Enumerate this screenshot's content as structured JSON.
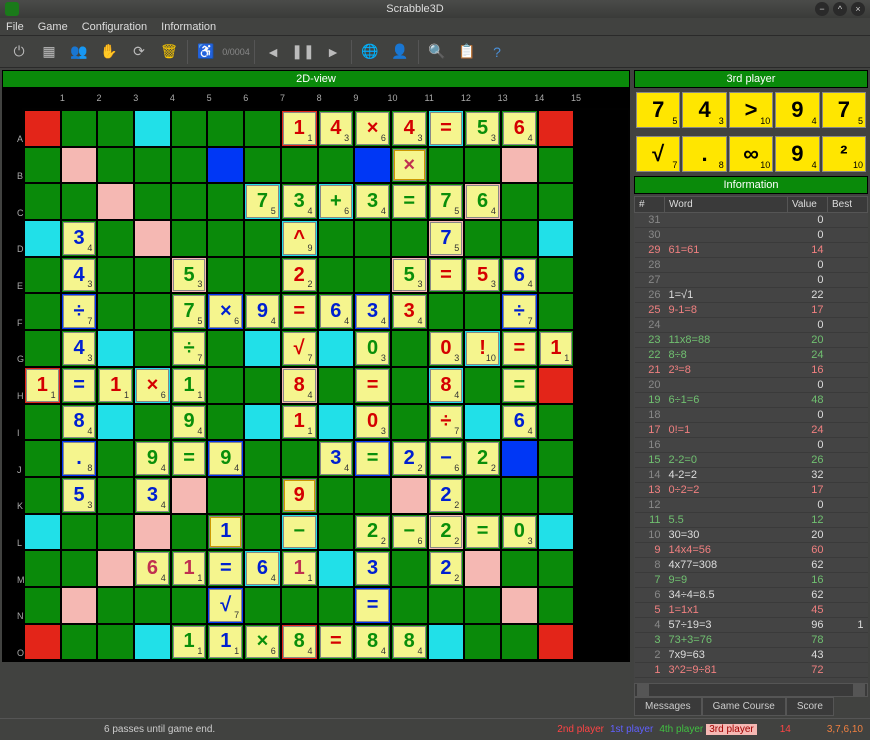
{
  "window": {
    "title": "Scrabble3D"
  },
  "menu": [
    "File",
    "Game",
    "Configuration",
    "Information"
  ],
  "view_header": "2D-view",
  "player_header": "3rd player",
  "info_header": "Information",
  "status": {
    "msg": "6 passes until game end.",
    "players": [
      "2nd player",
      "1st player",
      "4th player",
      "3rd player"
    ],
    "n1": "14",
    "n2": "3,7,6,10"
  },
  "cols": [
    "1",
    "2",
    "3",
    "4",
    "5",
    "6",
    "7",
    "8",
    "9",
    "10",
    "11",
    "12",
    "13",
    "14",
    "15"
  ],
  "rows": [
    "A",
    "B",
    "C",
    "D",
    "E",
    "F",
    "G",
    "H",
    "I",
    "J",
    "K",
    "L",
    "M",
    "N",
    "O"
  ],
  "rack": [
    {
      "ch": "7",
      "sub": "5"
    },
    {
      "ch": "4",
      "sub": "3"
    },
    {
      "ch": ">",
      "sub": "10"
    },
    {
      "ch": "9",
      "sub": "4"
    },
    {
      "ch": "7",
      "sub": "5"
    },
    {
      "ch": "√",
      "sub": "7"
    },
    {
      "ch": ".",
      "sub": "8"
    },
    {
      "ch": "∞",
      "sub": "10"
    },
    {
      "ch": "9",
      "sub": "4"
    },
    {
      "ch": "²",
      "sub": "10"
    }
  ],
  "info_cols": [
    "#",
    "Word",
    "Value",
    "Best"
  ],
  "info_rows": [
    {
      "n": "31",
      "w": "",
      "v": "0",
      "c": ""
    },
    {
      "n": "30",
      "w": "",
      "v": "0",
      "c": ""
    },
    {
      "n": "29",
      "w": "61=61",
      "v": "14",
      "c": "red"
    },
    {
      "n": "28",
      "w": "",
      "v": "0",
      "c": ""
    },
    {
      "n": "27",
      "w": "",
      "v": "0",
      "c": ""
    },
    {
      "n": "26",
      "w": "1=√1",
      "v": "22",
      "c": ""
    },
    {
      "n": "25",
      "w": "9-1=8",
      "v": "17",
      "c": "red"
    },
    {
      "n": "24",
      "w": "",
      "v": "0",
      "c": ""
    },
    {
      "n": "23",
      "w": "11x8=88",
      "v": "20",
      "c": "grn"
    },
    {
      "n": "22",
      "w": "8÷8",
      "v": "24",
      "c": "grn"
    },
    {
      "n": "21",
      "w": "2³=8",
      "v": "16",
      "c": "red"
    },
    {
      "n": "20",
      "w": "",
      "v": "0",
      "c": ""
    },
    {
      "n": "19",
      "w": "6÷1=6",
      "v": "48",
      "c": "grn"
    },
    {
      "n": "18",
      "w": "",
      "v": "0",
      "c": ""
    },
    {
      "n": "17",
      "w": "0!=1",
      "v": "24",
      "c": "red"
    },
    {
      "n": "16",
      "w": "",
      "v": "0",
      "c": ""
    },
    {
      "n": "15",
      "w": "2-2=0",
      "v": "26",
      "c": "grn"
    },
    {
      "n": "14",
      "w": "4-2=2",
      "v": "32",
      "c": ""
    },
    {
      "n": "13",
      "w": "0÷2=2",
      "v": "17",
      "c": "red"
    },
    {
      "n": "12",
      "w": "",
      "v": "0",
      "c": ""
    },
    {
      "n": "11",
      "w": "5.5",
      "v": "12",
      "c": "grn"
    },
    {
      "n": "10",
      "w": "30=30",
      "v": "20",
      "c": ""
    },
    {
      "n": "9",
      "w": "14x4=56",
      "v": "60",
      "c": "red"
    },
    {
      "n": "8",
      "w": "4x77=308",
      "v": "62",
      "c": ""
    },
    {
      "n": "7",
      "w": "9=9",
      "v": "16",
      "c": "grn"
    },
    {
      "n": "6",
      "w": "34÷4=8.5",
      "v": "62",
      "c": ""
    },
    {
      "n": "5",
      "w": "1=1x1",
      "v": "45",
      "c": "red"
    },
    {
      "n": "4",
      "w": "57÷19=3",
      "v": "96",
      "c": "",
      "b": "1"
    },
    {
      "n": "3",
      "w": "73+3=76",
      "v": "78",
      "c": "grn"
    },
    {
      "n": "2",
      "w": "7x9=63",
      "v": "43",
      "c": ""
    },
    {
      "n": "1",
      "w": "3^2=9÷81",
      "v": "72",
      "c": "red"
    }
  ],
  "tabs": [
    "Messages",
    "Game Course",
    "Score"
  ],
  "tiles": [
    {
      "r": 0,
      "c": 8,
      "ch": "1",
      "sub": "1",
      "cl": "r"
    },
    {
      "r": 0,
      "c": 9,
      "ch": "4",
      "sub": "3",
      "cl": "r"
    },
    {
      "r": 0,
      "c": 10,
      "ch": "×",
      "sub": "6",
      "cl": "r"
    },
    {
      "r": 0,
      "c": 11,
      "ch": "4",
      "sub": "3",
      "cl": "r"
    },
    {
      "r": 0,
      "c": 12,
      "ch": "=",
      "sub": "",
      "cl": "r"
    },
    {
      "r": 0,
      "c": 13,
      "ch": "5",
      "sub": "3",
      "cl": "g"
    },
    {
      "r": 0,
      "c": 14,
      "ch": "6",
      "sub": "4",
      "cl": "r"
    },
    {
      "r": 1,
      "c": 11,
      "ch": "×",
      "sub": "",
      "cl": "m",
      "y": 1
    },
    {
      "r": 2,
      "c": 7,
      "ch": "7",
      "sub": "5",
      "cl": "g"
    },
    {
      "r": 2,
      "c": 8,
      "ch": "3",
      "sub": "4",
      "cl": "g"
    },
    {
      "r": 2,
      "c": 9,
      "ch": "+",
      "sub": "6",
      "cl": "g"
    },
    {
      "r": 2,
      "c": 10,
      "ch": "3",
      "sub": "4",
      "cl": "g"
    },
    {
      "r": 2,
      "c": 11,
      "ch": "=",
      "sub": "",
      "cl": "g"
    },
    {
      "r": 2,
      "c": 12,
      "ch": "7",
      "sub": "5",
      "cl": "g"
    },
    {
      "r": 2,
      "c": 13,
      "ch": "6",
      "sub": "4",
      "cl": "g"
    },
    {
      "r": 3,
      "c": 2,
      "ch": "3",
      "sub": "4",
      "cl": "b"
    },
    {
      "r": 3,
      "c": 8,
      "ch": "^",
      "sub": "9",
      "cl": "r"
    },
    {
      "r": 3,
      "c": 12,
      "ch": "7",
      "sub": "5",
      "cl": "b"
    },
    {
      "r": 4,
      "c": 2,
      "ch": "4",
      "sub": "3",
      "cl": "b"
    },
    {
      "r": 4,
      "c": 5,
      "ch": "5",
      "sub": "3",
      "cl": "g"
    },
    {
      "r": 4,
      "c": 8,
      "ch": "2",
      "sub": "2",
      "cl": "r"
    },
    {
      "r": 4,
      "c": 11,
      "ch": "5",
      "sub": "3",
      "cl": "g"
    },
    {
      "r": 4,
      "c": 12,
      "ch": "=",
      "sub": "",
      "cl": "r"
    },
    {
      "r": 4,
      "c": 13,
      "ch": "5",
      "sub": "3",
      "cl": "r"
    },
    {
      "r": 4,
      "c": 14,
      "ch": "6",
      "sub": "4",
      "cl": "b"
    },
    {
      "r": 5,
      "c": 2,
      "ch": "÷",
      "sub": "7",
      "cl": "b"
    },
    {
      "r": 5,
      "c": 5,
      "ch": "7",
      "sub": "5",
      "cl": "g"
    },
    {
      "r": 5,
      "c": 6,
      "ch": "×",
      "sub": "6",
      "cl": "b"
    },
    {
      "r": 5,
      "c": 7,
      "ch": "9",
      "sub": "4",
      "cl": "b"
    },
    {
      "r": 5,
      "c": 8,
      "ch": "=",
      "sub": "",
      "cl": "r"
    },
    {
      "r": 5,
      "c": 9,
      "ch": "6",
      "sub": "4",
      "cl": "b"
    },
    {
      "r": 5,
      "c": 10,
      "ch": "3",
      "sub": "4",
      "cl": "b"
    },
    {
      "r": 5,
      "c": 11,
      "ch": "3",
      "sub": "4",
      "cl": "r"
    },
    {
      "r": 5,
      "c": 14,
      "ch": "÷",
      "sub": "7",
      "cl": "b"
    },
    {
      "r": 6,
      "c": 2,
      "ch": "4",
      "sub": "3",
      "cl": "b"
    },
    {
      "r": 6,
      "c": 5,
      "ch": "÷",
      "sub": "7",
      "cl": "g"
    },
    {
      "r": 6,
      "c": 8,
      "ch": "√",
      "sub": "7",
      "cl": "r"
    },
    {
      "r": 6,
      "c": 10,
      "ch": "0",
      "sub": "3",
      "cl": "g"
    },
    {
      "r": 6,
      "c": 12,
      "ch": "0",
      "sub": "3",
      "cl": "r"
    },
    {
      "r": 6,
      "c": 13,
      "ch": "!",
      "sub": "10",
      "cl": "r"
    },
    {
      "r": 6,
      "c": 14,
      "ch": "=",
      "sub": "",
      "cl": "r"
    },
    {
      "r": 6,
      "c": 15,
      "ch": "1",
      "sub": "1",
      "cl": "r"
    },
    {
      "r": 7,
      "c": 1,
      "ch": "1",
      "sub": "1",
      "cl": "r"
    },
    {
      "r": 7,
      "c": 2,
      "ch": "=",
      "sub": "",
      "cl": "b"
    },
    {
      "r": 7,
      "c": 3,
      "ch": "1",
      "sub": "1",
      "cl": "r"
    },
    {
      "r": 7,
      "c": 4,
      "ch": "×",
      "sub": "6",
      "cl": "r"
    },
    {
      "r": 7,
      "c": 5,
      "ch": "1",
      "sub": "1",
      "cl": "g"
    },
    {
      "r": 7,
      "c": 8,
      "ch": "8",
      "sub": "4",
      "cl": "r"
    },
    {
      "r": 7,
      "c": 10,
      "ch": "=",
      "sub": "",
      "cl": "r"
    },
    {
      "r": 7,
      "c": 12,
      "ch": "8",
      "sub": "4",
      "cl": "r"
    },
    {
      "r": 7,
      "c": 14,
      "ch": "=",
      "sub": "",
      "cl": "g"
    },
    {
      "r": 8,
      "c": 2,
      "ch": "8",
      "sub": "4",
      "cl": "b"
    },
    {
      "r": 8,
      "c": 5,
      "ch": "9",
      "sub": "4",
      "cl": "g"
    },
    {
      "r": 8,
      "c": 8,
      "ch": "1",
      "sub": "1",
      "cl": "r"
    },
    {
      "r": 8,
      "c": 10,
      "ch": "0",
      "sub": "3",
      "cl": "r"
    },
    {
      "r": 8,
      "c": 12,
      "ch": "÷",
      "sub": "7",
      "cl": "r"
    },
    {
      "r": 8,
      "c": 14,
      "ch": "6",
      "sub": "4",
      "cl": "b"
    },
    {
      "r": 9,
      "c": 2,
      "ch": ".",
      "sub": "8",
      "cl": "b"
    },
    {
      "r": 9,
      "c": 4,
      "ch": "9",
      "sub": "4",
      "cl": "g"
    },
    {
      "r": 9,
      "c": 5,
      "ch": "=",
      "sub": "",
      "cl": "g"
    },
    {
      "r": 9,
      "c": 6,
      "ch": "9",
      "sub": "4",
      "cl": "g"
    },
    {
      "r": 9,
      "c": 9,
      "ch": "3",
      "sub": "4",
      "cl": "b"
    },
    {
      "r": 9,
      "c": 10,
      "ch": "=",
      "sub": "",
      "cl": "g"
    },
    {
      "r": 9,
      "c": 11,
      "ch": "2",
      "sub": "2",
      "cl": "b"
    },
    {
      "r": 9,
      "c": 12,
      "ch": "−",
      "sub": "6",
      "cl": "b"
    },
    {
      "r": 9,
      "c": 13,
      "ch": "2",
      "sub": "2",
      "cl": "g"
    },
    {
      "r": 10,
      "c": 2,
      "ch": "5",
      "sub": "3",
      "cl": "b"
    },
    {
      "r": 10,
      "c": 4,
      "ch": "3",
      "sub": "4",
      "cl": "b"
    },
    {
      "r": 10,
      "c": 8,
      "ch": "9",
      "sub": "",
      "cl": "r",
      "y": 1
    },
    {
      "r": 10,
      "c": 12,
      "ch": "2",
      "sub": "2",
      "cl": "b"
    },
    {
      "r": 11,
      "c": 6,
      "ch": "1",
      "sub": "",
      "cl": "b",
      "y": 1
    },
    {
      "r": 11,
      "c": 8,
      "ch": "−",
      "sub": "",
      "cl": "g"
    },
    {
      "r": 11,
      "c": 10,
      "ch": "2",
      "sub": "2",
      "cl": "g"
    },
    {
      "r": 11,
      "c": 11,
      "ch": "−",
      "sub": "6",
      "cl": "g"
    },
    {
      "r": 11,
      "c": 12,
      "ch": "2",
      "sub": "2",
      "cl": "g"
    },
    {
      "r": 11,
      "c": 13,
      "ch": "=",
      "sub": "",
      "cl": "g"
    },
    {
      "r": 11,
      "c": 14,
      "ch": "0",
      "sub": "3",
      "cl": "g"
    },
    {
      "r": 12,
      "c": 4,
      "ch": "6",
      "sub": "4",
      "cl": "m"
    },
    {
      "r": 12,
      "c": 5,
      "ch": "1",
      "sub": "1",
      "cl": "m"
    },
    {
      "r": 12,
      "c": 6,
      "ch": "=",
      "sub": "",
      "cl": "b"
    },
    {
      "r": 12,
      "c": 7,
      "ch": "6",
      "sub": "4",
      "cl": "b"
    },
    {
      "r": 12,
      "c": 8,
      "ch": "1",
      "sub": "1",
      "cl": "m"
    },
    {
      "r": 12,
      "c": 10,
      "ch": "3",
      "sub": "",
      "cl": "b"
    },
    {
      "r": 12,
      "c": 12,
      "ch": "2",
      "sub": "2",
      "cl": "b"
    },
    {
      "r": 13,
      "c": 6,
      "ch": "√",
      "sub": "7",
      "cl": "b"
    },
    {
      "r": 13,
      "c": 10,
      "ch": "=",
      "sub": "",
      "cl": "b"
    },
    {
      "r": 14,
      "c": 5,
      "ch": "1",
      "sub": "1",
      "cl": "g"
    },
    {
      "r": 14,
      "c": 6,
      "ch": "1",
      "sub": "1",
      "cl": "b"
    },
    {
      "r": 14,
      "c": 7,
      "ch": "×",
      "sub": "6",
      "cl": "g"
    },
    {
      "r": 14,
      "c": 8,
      "ch": "8",
      "sub": "4",
      "cl": "g"
    },
    {
      "r": 14,
      "c": 9,
      "ch": "=",
      "sub": "",
      "cl": "r"
    },
    {
      "r": 14,
      "c": 10,
      "ch": "8",
      "sub": "4",
      "cl": "g"
    },
    {
      "r": 14,
      "c": 11,
      "ch": "8",
      "sub": "4",
      "cl": "g"
    }
  ],
  "board_layout": [
    "1..4...1...4..1",
    ".2...3...3...2.",
    "..2...4.4...2..",
    "4..2...4...2..4",
    "....2.....2....",
    ".3...3...3...3.",
    "..4...4.4...4..",
    "1..4...2...4..1",
    "..4...4.4...4..",
    ".3...3...3...3.",
    "....2.....2....",
    "4..2...4...2..4",
    "..2...4.4...2..",
    ".2...3...3...2.",
    "1..4...1...4..1"
  ]
}
